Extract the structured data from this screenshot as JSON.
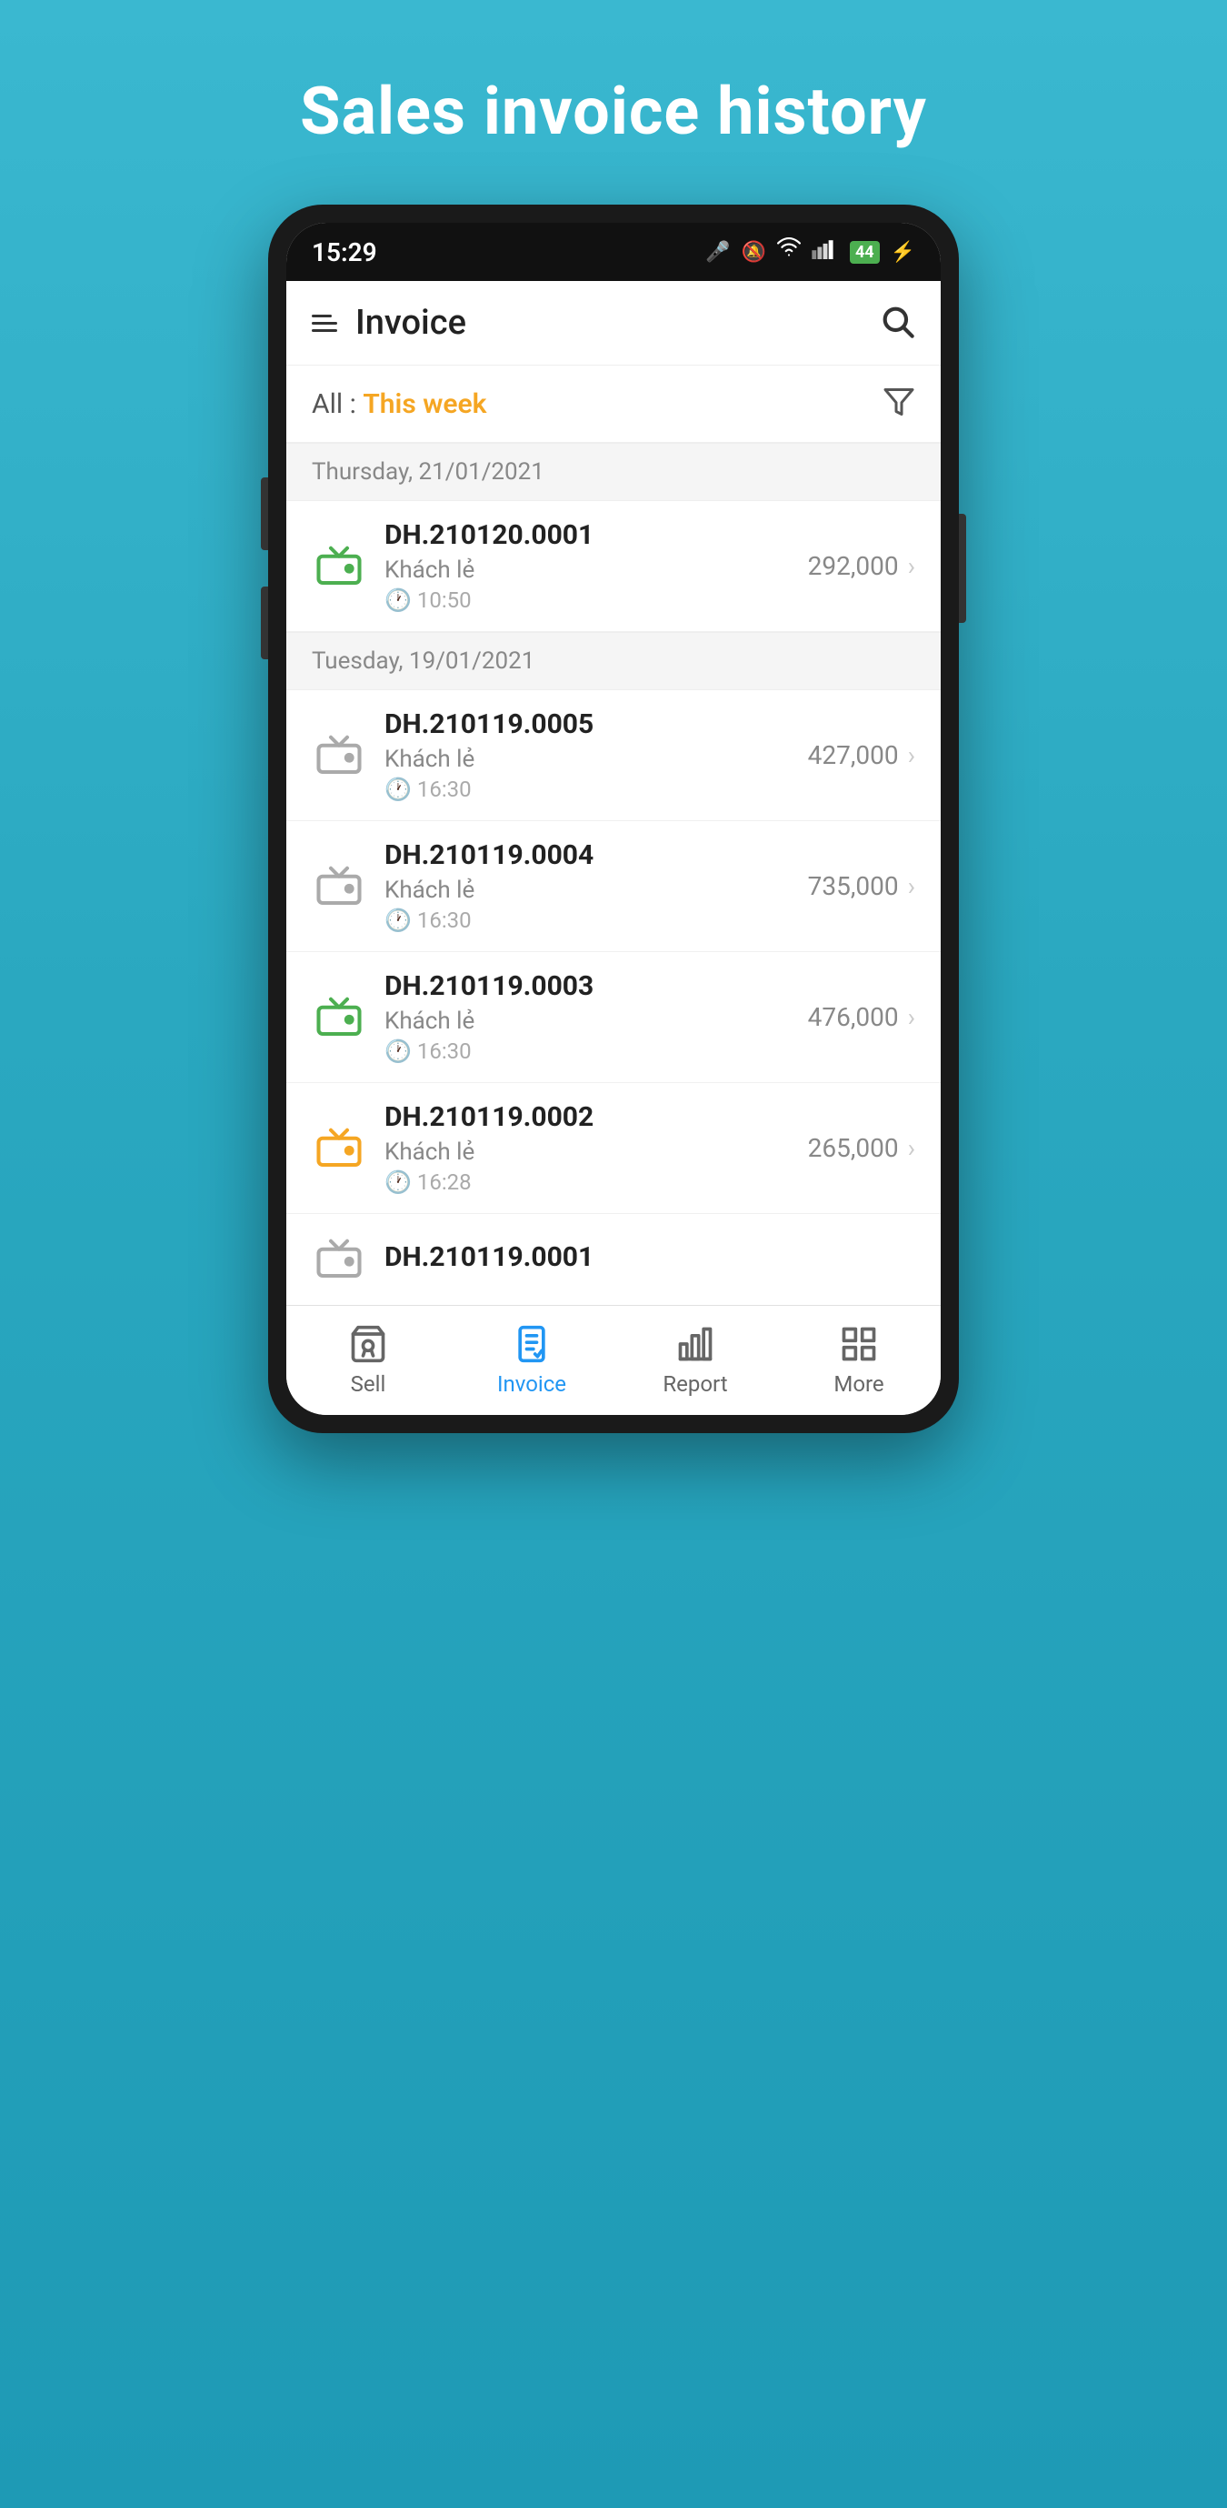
{
  "page": {
    "bg_title": "Sales invoice history"
  },
  "status_bar": {
    "time": "15:29",
    "battery": "44"
  },
  "app_header": {
    "title": "Invoice"
  },
  "filter": {
    "label": "All",
    "separator": " : ",
    "period": "This week"
  },
  "invoice_groups": [
    {
      "date_label": "Thursday, 21/01/2021",
      "invoices": [
        {
          "number": "DH.210120.0001",
          "customer": "Khách lẻ",
          "time": "10:50",
          "amount": "292,000",
          "icon_color": "green"
        }
      ]
    },
    {
      "date_label": "Tuesday, 19/01/2021",
      "invoices": [
        {
          "number": "DH.210119.0005",
          "customer": "Khách lẻ",
          "time": "16:30",
          "amount": "427,000",
          "icon_color": "gray"
        },
        {
          "number": "DH.210119.0004",
          "customer": "Khách lẻ",
          "time": "16:30",
          "amount": "735,000",
          "icon_color": "gray"
        },
        {
          "number": "DH.210119.0003",
          "customer": "Khách lẻ",
          "time": "16:30",
          "amount": "476,000",
          "icon_color": "green"
        },
        {
          "number": "DH.210119.0002",
          "customer": "Khách lẻ",
          "time": "16:28",
          "amount": "265,000",
          "icon_color": "orange"
        },
        {
          "number": "DH.210119.0001",
          "customer": "",
          "time": "",
          "amount": "",
          "icon_color": "gray",
          "partial": true
        }
      ]
    }
  ],
  "bottom_nav": {
    "items": [
      {
        "label": "Sell",
        "active": false
      },
      {
        "label": "Invoice",
        "active": true
      },
      {
        "label": "Report",
        "active": false
      },
      {
        "label": "More",
        "active": false
      }
    ]
  }
}
